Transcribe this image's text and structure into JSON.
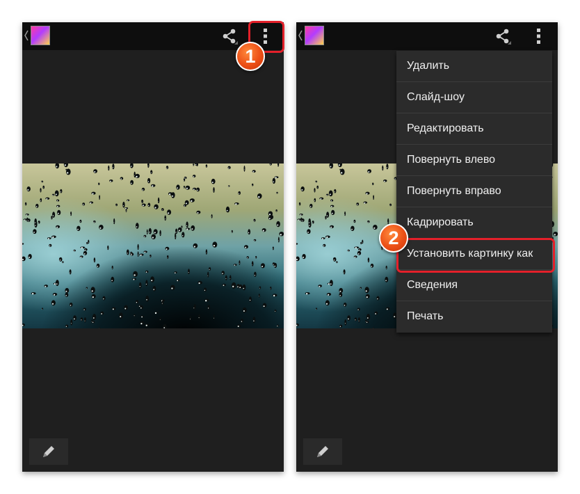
{
  "colors": {
    "highlight": "#e4202a",
    "marker": "#ec4f16",
    "background": "#1f1f1f",
    "action_bar": "#0e0e0e",
    "menu_background": "#2b2b2b"
  },
  "left_screen": {
    "action_bar": {
      "icons": [
        "back-chevron-icon",
        "gallery-app-icon",
        "share-icon",
        "overflow-menu-icon"
      ]
    },
    "bottom_button_icon": "pencil-icon"
  },
  "right_screen": {
    "action_bar": {
      "icons": [
        "back-chevron-icon",
        "gallery-app-icon",
        "share-icon",
        "overflow-menu-icon"
      ]
    },
    "menu": {
      "items": [
        "Удалить",
        "Слайд-шоу",
        "Редактировать",
        "Повернуть влево",
        "Повернуть вправо",
        "Кадрировать",
        "Установить картинку как",
        "Сведения",
        "Печать"
      ],
      "highlighted_item": "Установить картинку как"
    },
    "bottom_button_icon": "pencil-icon"
  },
  "annotations": {
    "step1": "1",
    "step2": "2"
  }
}
